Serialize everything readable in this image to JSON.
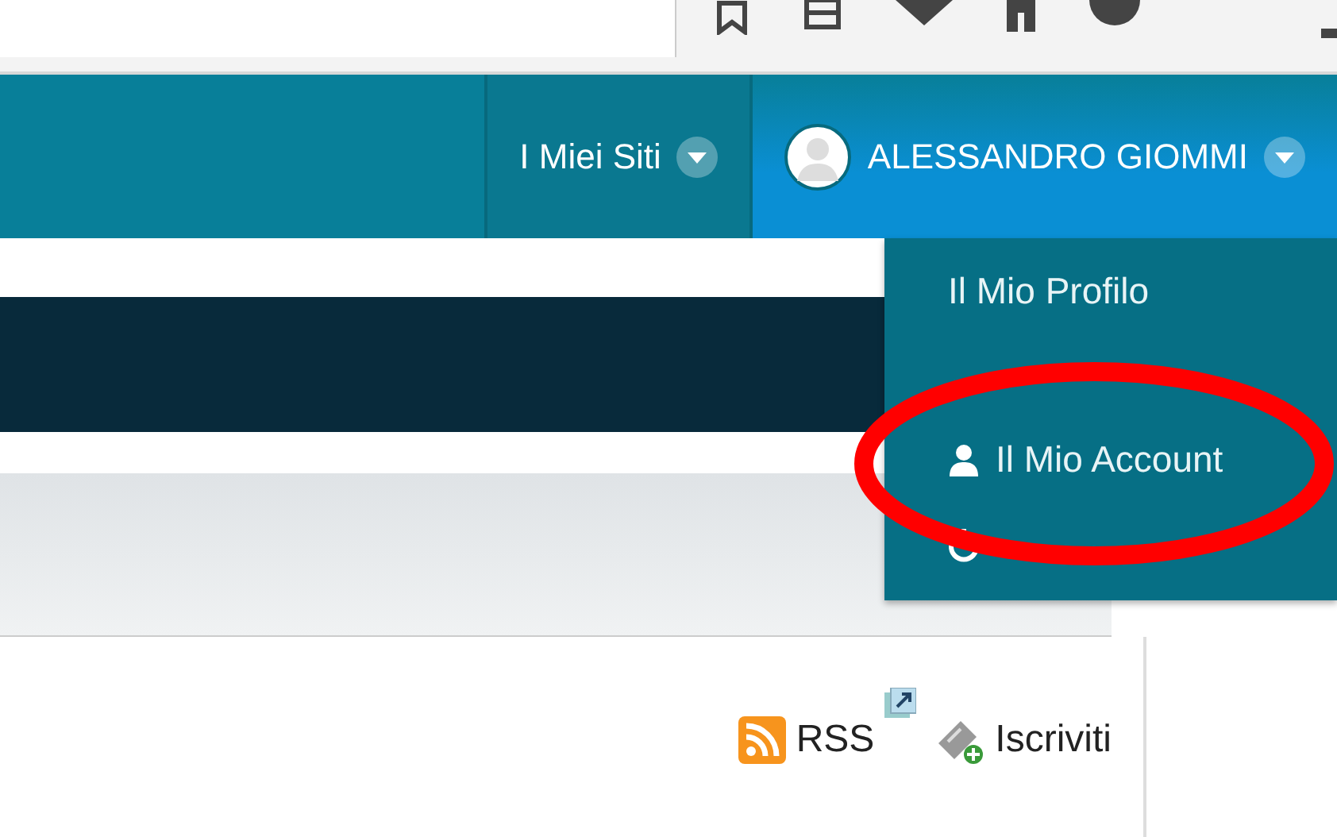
{
  "nav": {
    "tabs": [
      {
        "label": "I Miei Siti",
        "selected": false
      },
      {
        "label": "ALESSANDRO GIOMMI",
        "selected": true
      }
    ]
  },
  "dropdown": {
    "items": [
      {
        "label": "Il Mio Profilo",
        "kind": "text"
      },
      {
        "kind": "text"
      },
      {
        "label": "Il Mio Account",
        "kind": "user"
      },
      {
        "kind": "power"
      }
    ]
  },
  "feed_links": [
    {
      "label": "RSS",
      "kind": "rss"
    },
    {
      "label": "Iscriviti",
      "kind": "subscribe"
    }
  ]
}
